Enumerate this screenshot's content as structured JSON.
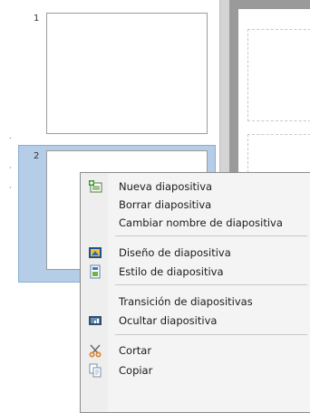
{
  "slides": [
    {
      "number": "1"
    },
    {
      "number": "2",
      "selected": true
    }
  ],
  "side_marks": [
    ".",
    "·",
    "·"
  ],
  "context_menu": {
    "items": [
      {
        "label": "Nueva diapositiva",
        "icon": "new-slide-icon"
      },
      {
        "label": "Borrar diapositiva",
        "icon": null
      },
      {
        "label": "Cambiar nombre de diapositiva",
        "icon": null
      },
      {
        "label": "Diseño de diapositiva",
        "icon": "slide-layout-icon"
      },
      {
        "label": "Estilo de diapositiva",
        "icon": "slide-style-icon"
      },
      {
        "label": "Transición de diapositivas",
        "icon": null
      },
      {
        "label": "Ocultar diapositiva",
        "icon": "hide-slide-icon"
      },
      {
        "label": "Cortar",
        "icon": "cut-icon"
      },
      {
        "label": "Copiar",
        "icon": "copy-icon"
      }
    ]
  },
  "colors": {
    "selection": "#b5cde6",
    "menu_bg": "#f4f4f4",
    "editor_bg": "#9a9a9a"
  }
}
